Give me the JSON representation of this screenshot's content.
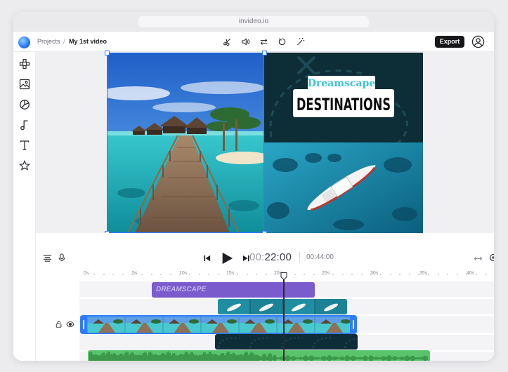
{
  "browser": {
    "url": "invideo.io"
  },
  "header": {
    "breadcrumb_root": "Projects",
    "breadcrumb_separator": "/",
    "breadcrumb_current": "My 1st video",
    "export_label": "Export",
    "tools": [
      "scissors-icon",
      "volume-icon",
      "swap-icon",
      "rotate-icon",
      "magic-wand-icon"
    ]
  },
  "sidebar": {
    "items": [
      "elements-icon",
      "media-icon",
      "stickers-icon",
      "music-icon",
      "text-icon",
      "favorites-icon"
    ]
  },
  "canvas": {
    "title_line1": "Dreamscape",
    "title_line2": "DESTINATIONS"
  },
  "timeline": {
    "time_dim": "00:",
    "time_bright": "22:00",
    "duration": "00:44:00",
    "ruler": [
      "0s",
      "5s",
      "10s",
      "15s",
      "20s",
      "25s",
      "30s",
      "35s",
      "40s"
    ],
    "text_clip_label": "DREAMSCAPE",
    "playhead_seconds": 20.5
  },
  "colors": {
    "accent": "#2f7bff",
    "text_clip": "#7a5ccd",
    "audio_clip": "#59c46b",
    "panel_dark": "#0d2d37",
    "title_cyan": "#39c3d9"
  }
}
